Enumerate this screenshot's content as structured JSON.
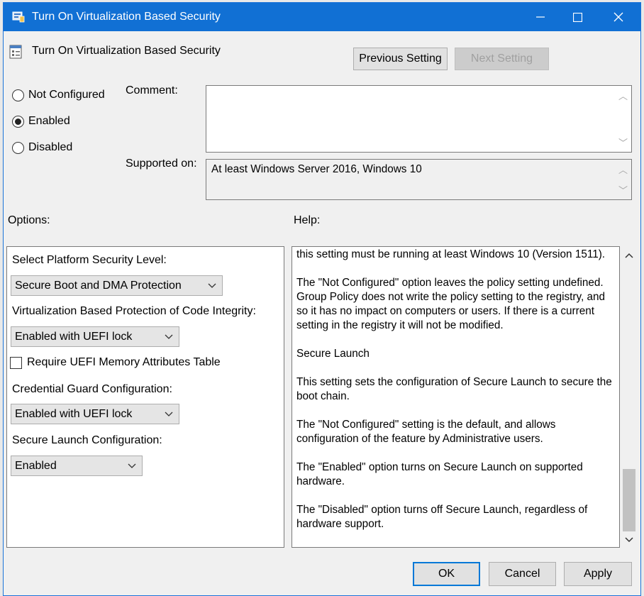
{
  "window": {
    "title": "Turn On Virtualization Based Security",
    "minimize": "—",
    "maximize": "☐",
    "close": "✕"
  },
  "header": {
    "setting_title": "Turn On Virtualization Based Security",
    "previous_label": "Previous Setting",
    "next_label": "Next Setting"
  },
  "state": {
    "options": [
      {
        "label": "Not Configured",
        "selected": false
      },
      {
        "label": "Enabled",
        "selected": true
      },
      {
        "label": "Disabled",
        "selected": false
      }
    ]
  },
  "comment": {
    "label": "Comment:",
    "value": ""
  },
  "supported": {
    "label": "Supported on:",
    "value": "At least Windows Server 2016, Windows 10"
  },
  "options_panel": {
    "heading": "Options:",
    "platform_label": "Select Platform Security Level:",
    "platform_value": "Secure Boot and DMA Protection",
    "vbs_label": "Virtualization Based Protection of Code Integrity:",
    "vbs_value": "Enabled with UEFI lock",
    "uefi_mat_label": "Require UEFI Memory Attributes Table",
    "cred_guard_label": "Credential Guard Configuration:",
    "cred_guard_value": "Enabled with UEFI lock",
    "secure_launch_label": "Secure Launch Configuration:",
    "secure_launch_value": "Enabled"
  },
  "help_panel": {
    "heading": "Help:",
    "paragraphs": [
      "this setting must be running at least Windows 10 (Version 1511).",
      "The \"Not Configured\" option leaves the policy setting undefined. Group Policy does not write the policy setting to the registry, and so it has no impact on computers or users. If there is a current setting in the registry it will not be modified.",
      "Secure Launch",
      "This setting sets the configuration of Secure Launch to secure the boot chain.",
      "The \"Not Configured\" setting is the default, and allows configuration of the feature by Administrative users.",
      "The \"Enabled\" option turns on Secure Launch on supported hardware.",
      "The \"Disabled\" option turns off Secure Launch, regardless of hardware support."
    ]
  },
  "footer": {
    "ok_label": "OK",
    "cancel_label": "Cancel",
    "apply_label": "Apply"
  },
  "colors": {
    "titlebar": "#1170d4",
    "dialog_bg": "#f0f0f0",
    "default_border": "#0078d7"
  }
}
